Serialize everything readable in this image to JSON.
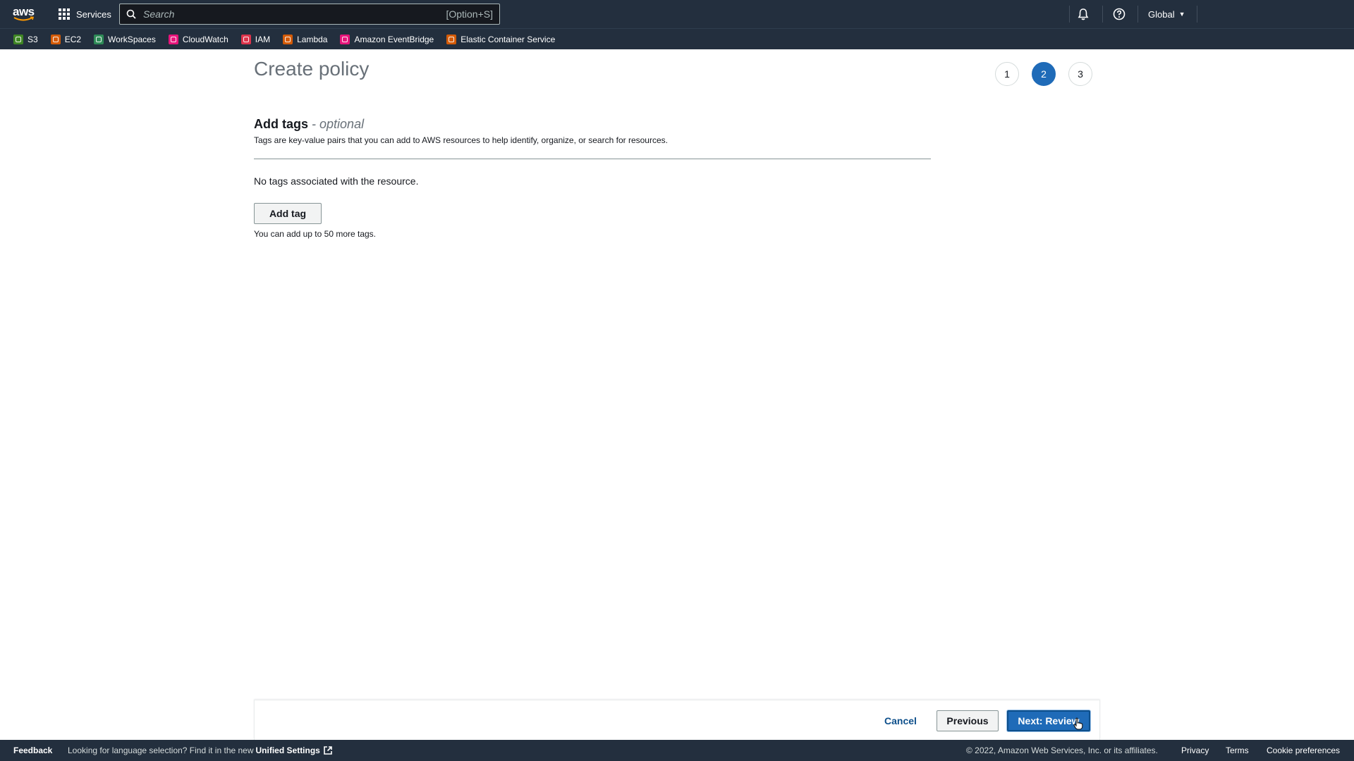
{
  "topnav": {
    "logo_text": "aws",
    "services_label": "Services",
    "search_placeholder": "Search",
    "search_shortcut": "[Option+S]",
    "region_label": "Global"
  },
  "favorites": [
    {
      "label": "S3",
      "color": "#3f8624"
    },
    {
      "label": "EC2",
      "color": "#d45b07"
    },
    {
      "label": "WorkSpaces",
      "color": "#2e8b57"
    },
    {
      "label": "CloudWatch",
      "color": "#e7157b"
    },
    {
      "label": "IAM",
      "color": "#dd344c"
    },
    {
      "label": "Lambda",
      "color": "#d45b07"
    },
    {
      "label": "Amazon EventBridge",
      "color": "#e7157b"
    },
    {
      "label": "Elastic Container Service",
      "color": "#d45b07"
    }
  ],
  "page": {
    "title": "Create policy",
    "steps": [
      "1",
      "2",
      "3"
    ],
    "active_step": "2"
  },
  "tags_section": {
    "title": "Add tags",
    "optional": "- optional",
    "description": "Tags are key-value pairs that you can add to AWS resources to help identify, organize, or search for resources.",
    "empty_message": "No tags associated with the resource.",
    "add_tag_label": "Add tag",
    "limit_note": "You can add up to 50 more tags."
  },
  "actions": {
    "cancel_label": "Cancel",
    "previous_label": "Previous",
    "next_label": "Next: Review"
  },
  "footer": {
    "feedback_label": "Feedback",
    "language_note": "Looking for language selection? Find it in the new",
    "unified_settings_label": "Unified Settings",
    "copyright": "© 2022, Amazon Web Services, Inc. or its affiliates.",
    "privacy_label": "Privacy",
    "terms_label": "Terms",
    "cookie_label": "Cookie preferences"
  },
  "colors": {
    "nav_bg": "#232f3e",
    "primary": "#1f6bb8",
    "link": "#0d4f8b"
  }
}
